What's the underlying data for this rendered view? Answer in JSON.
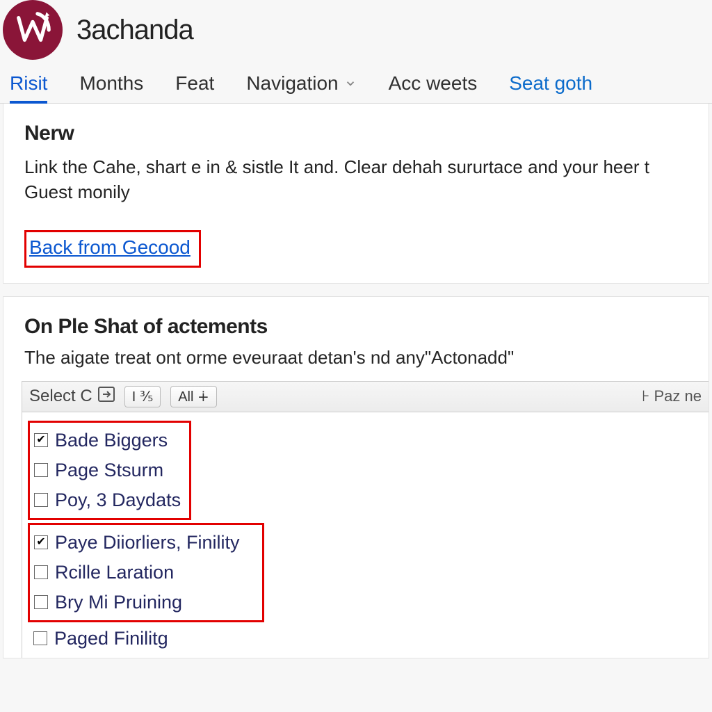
{
  "header": {
    "app_title": "3achanda"
  },
  "tabs": {
    "items": [
      {
        "label": "Risit",
        "active": true
      },
      {
        "label": "Months"
      },
      {
        "label": "Feat"
      },
      {
        "label": "Navigation",
        "has_chevron": true
      },
      {
        "label": "Acc weets"
      },
      {
        "label": "Seat goth",
        "link_style": true
      }
    ]
  },
  "notice": {
    "heading": "Nerw",
    "body": "Link the Cahe, shart e in & sistle It and. Clear dehah sururtace and your heer t Guest monily",
    "back_link": "Back from Gecood"
  },
  "section": {
    "heading": "On Ple Shat of actements",
    "sub": "The aigate treat ont orme eveuraat detan's nd any\"Actonadd\"",
    "toolbar": {
      "select_label": "Select C",
      "btn1": "I  ⅗",
      "btn_all": "All ∔",
      "pagination": "⊦ Paᴢ ne"
    },
    "items": [
      {
        "label": "Bade Biggers",
        "checked": true
      },
      {
        "label": "Page Stsurm",
        "checked": false
      },
      {
        "label": "Poy, 3 Daydats",
        "checked": false
      },
      {
        "label": "Paye Diiorliers, Finility",
        "checked": true
      },
      {
        "label": "Rcille Laration",
        "checked": false
      },
      {
        "label": "Bry Mi Pruining",
        "checked": false
      },
      {
        "label": "Paged  Finilitg",
        "checked": false
      }
    ]
  },
  "colors": {
    "accent": "#0b57d0",
    "highlight_border": "#e20000",
    "brand": "#8a1538"
  }
}
